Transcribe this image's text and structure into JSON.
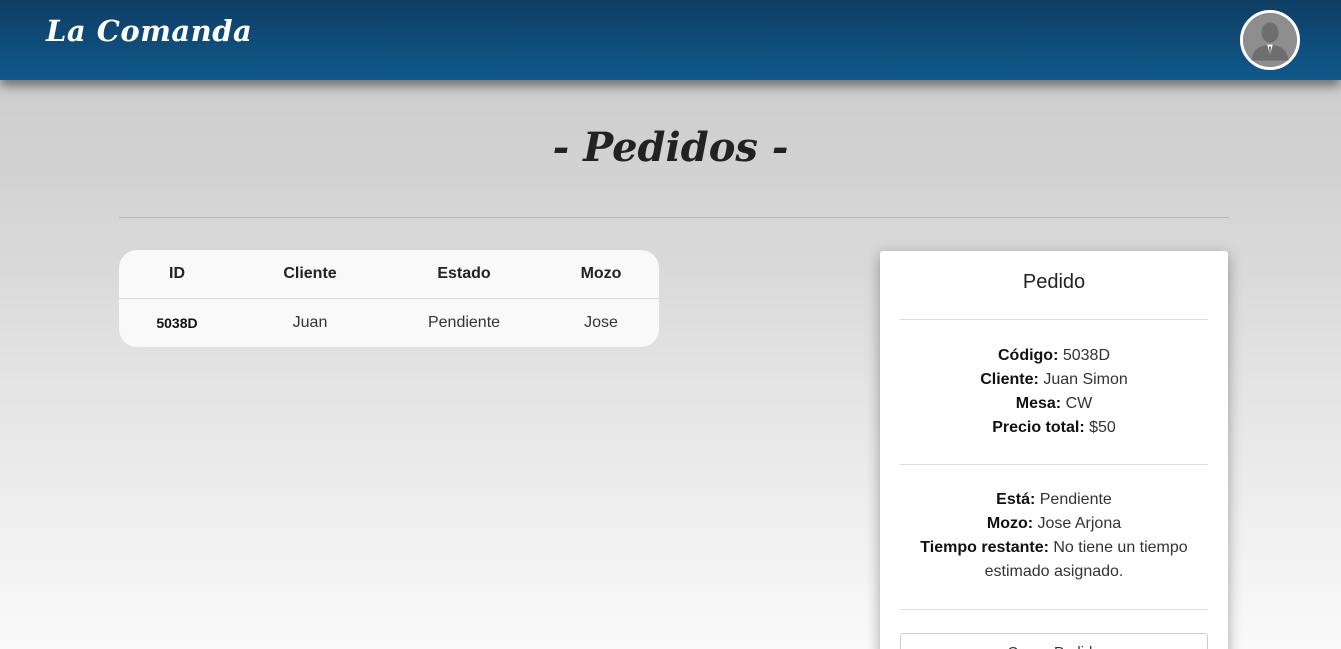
{
  "navbar": {
    "brand": "La Comanda",
    "avatar_icon": "user-avatar-icon"
  },
  "page": {
    "title": "- Pedidos -"
  },
  "table": {
    "headers": [
      "ID",
      "Cliente",
      "Estado",
      "Mozo"
    ],
    "rows": [
      {
        "id": "5038D",
        "cliente": "Juan",
        "estado": "Pendiente",
        "mozo": "Jose"
      }
    ]
  },
  "detail": {
    "title": "Pedido",
    "codigo_label": "Código:",
    "codigo": "5038D",
    "cliente_label": "Cliente:",
    "cliente": "Juan Simon",
    "mesa_label": "Mesa:",
    "mesa": "CW",
    "precio_label": "Precio total:",
    "precio": "$50",
    "estado_label": "Está:",
    "estado": "Pendiente",
    "mozo_label": "Mozo:",
    "mozo": "Jose Arjona",
    "tiempo_label": "Tiempo restante:",
    "tiempo": "No tiene un tiempo estimado asignado.",
    "button_label": "Cerrar Pedido"
  },
  "colors": {
    "navbar": "#0f5a8c",
    "background": "#d4d4d4"
  }
}
